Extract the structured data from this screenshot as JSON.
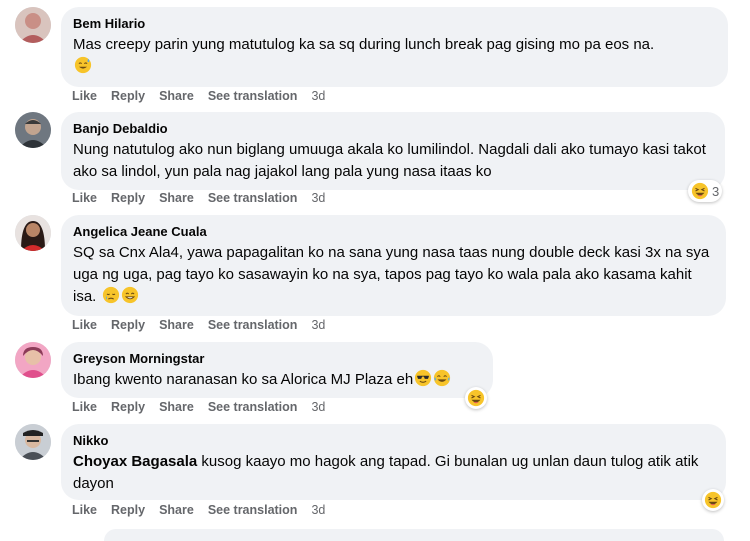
{
  "comments": [
    {
      "author": "Bem Hilario",
      "text": "Mas creepy parin yung matutulog ka sa sq during lunch break pag gising mo pa eos na.",
      "actions": {
        "like": "Like",
        "reply": "Reply",
        "share": "Share",
        "translate": "See translation"
      },
      "time": "3d"
    },
    {
      "author": "Banjo Debaldio",
      "text": "Nung natutulog ako nun biglang umuuga akala ko lumilindol. Nagdali dali ako tumayo kasi takot ako sa lindol, yun pala nag jajakol lang pala yung nasa itaas ko",
      "actions": {
        "like": "Like",
        "reply": "Reply",
        "share": "Share",
        "translate": "See translation"
      },
      "time": "3d",
      "reaction_count": "3"
    },
    {
      "author": "Angelica Jeane Cuala",
      "text": "SQ sa Cnx Ala4, yawa papagalitan ko na sana yung nasa taas nung double deck kasi 3x na sya uga ng uga, pag tayo ko sasawayin ko na sya, tapos pag tayo ko wala pala ako kasama kahit isa.",
      "actions": {
        "like": "Like",
        "reply": "Reply",
        "share": "Share",
        "translate": "See translation"
      },
      "time": "3d"
    },
    {
      "author": "Greyson Morningstar",
      "text": "Ibang kwento naranasan ko sa Alorica MJ Plaza eh",
      "actions": {
        "like": "Like",
        "reply": "Reply",
        "share": "Share",
        "translate": "See translation"
      },
      "time": "3d"
    },
    {
      "author": "Nikko",
      "mention": "Choyax Bagasala",
      "text": " kusog kaayo mo hagok ang tapad. Gi bunalan ug unlan daun tulog atik atik dayon",
      "actions": {
        "like": "Like",
        "reply": "Reply",
        "share": "Share",
        "translate": "See translation"
      },
      "time": "3d"
    }
  ],
  "icons": [
    "sweat-smile-emoji-icon",
    "laughing-emoji-icon",
    "crying-emoji-icon",
    "grin-emoji-icon",
    "sunglasses-emoji-icon",
    "tears-of-joy-emoji-icon",
    "haha-reaction-icon"
  ],
  "colors": {
    "bubble": "#f0f2f5",
    "text": "#050505",
    "secondary": "#65676b",
    "emoji": "#f7b125"
  }
}
